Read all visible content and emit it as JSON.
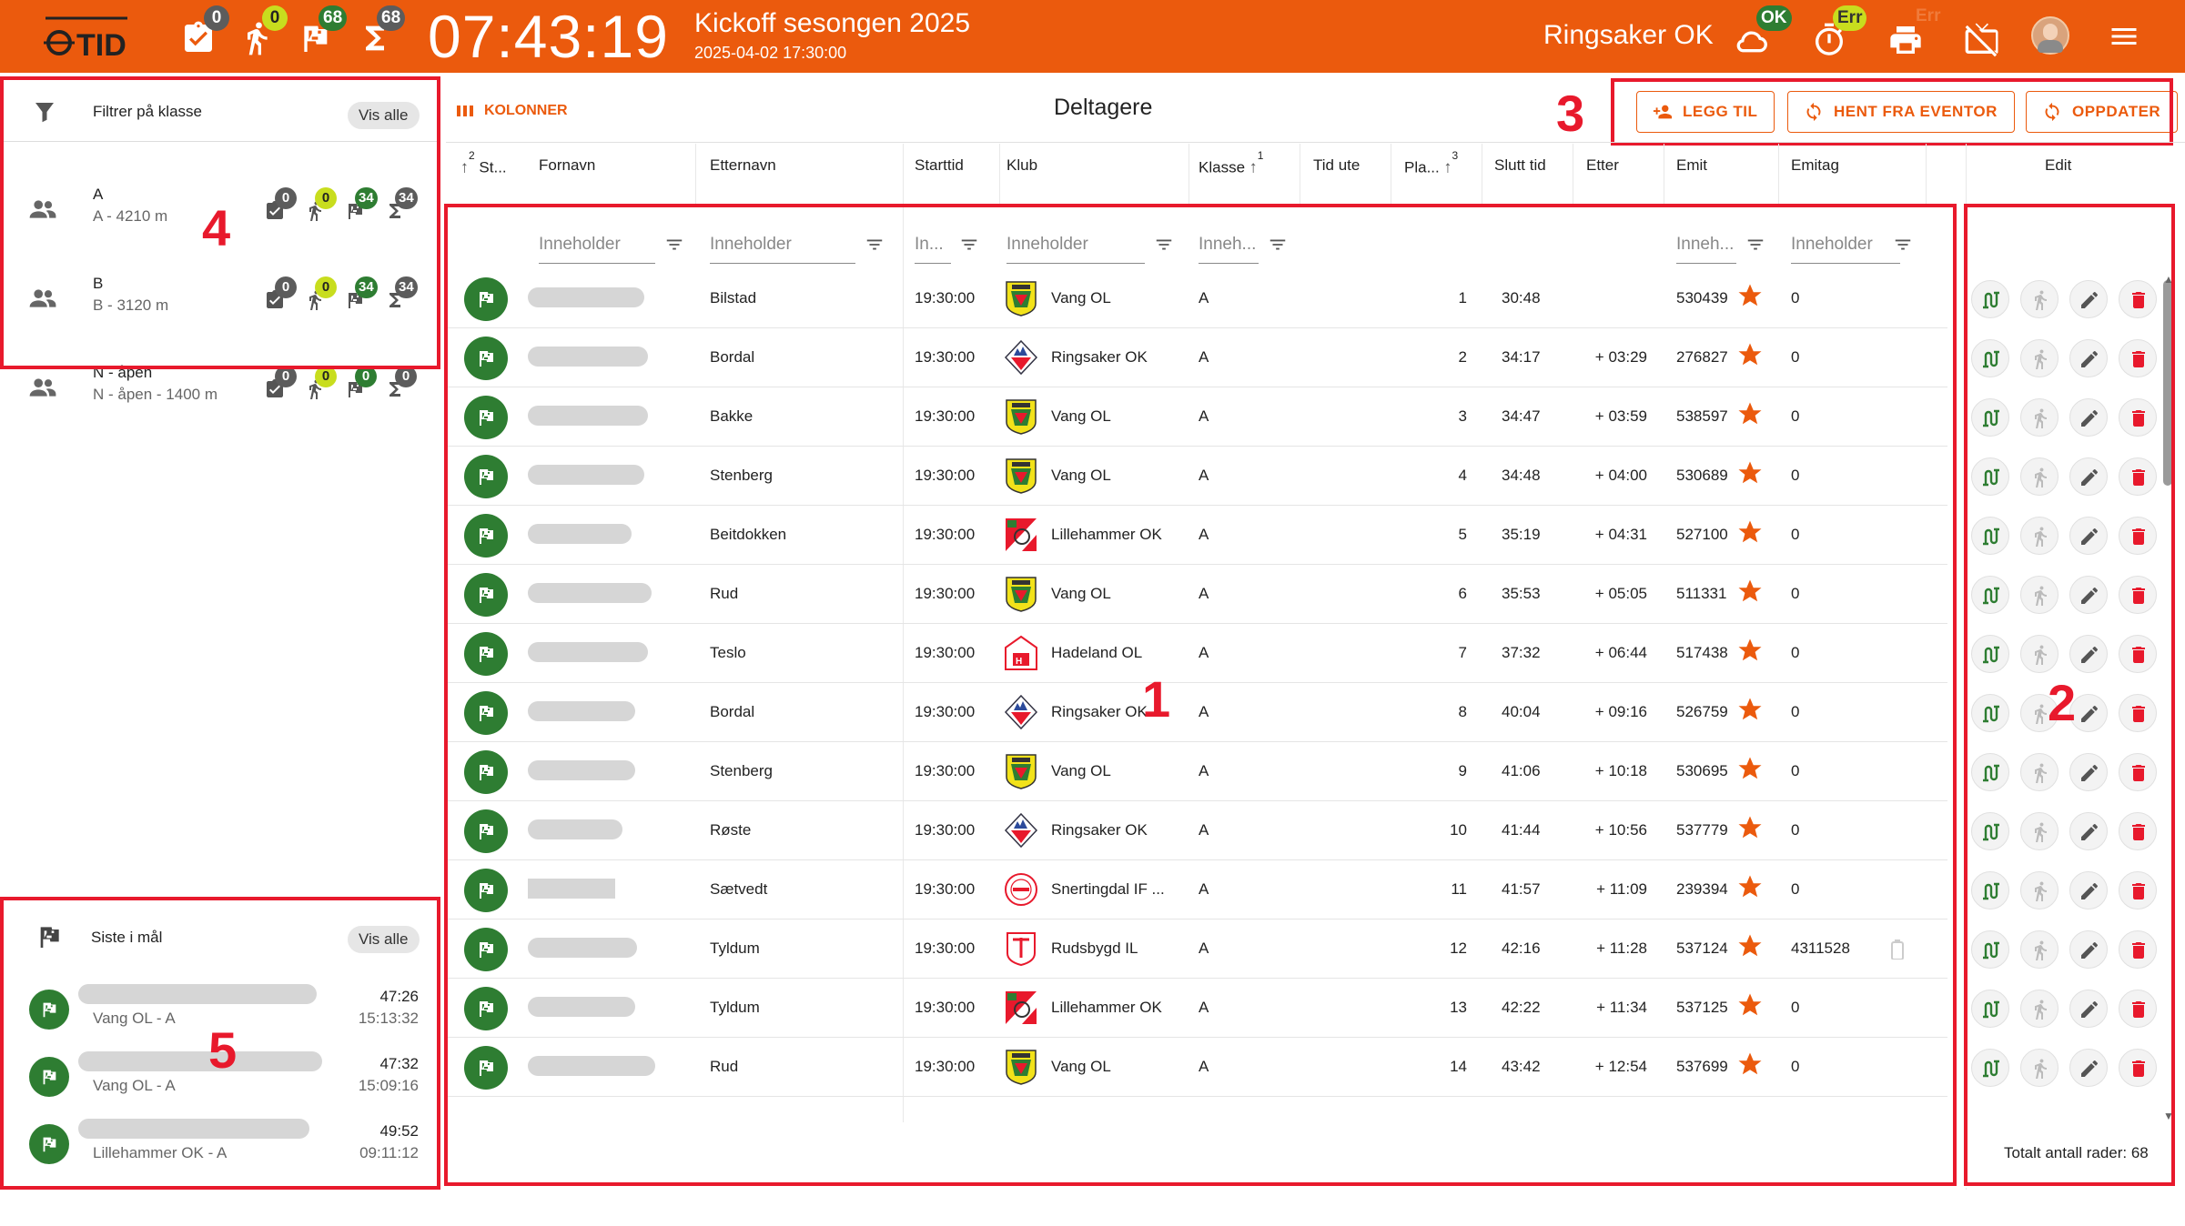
{
  "topbar": {
    "logo_text": "OTID",
    "counters": [
      {
        "icon": "clipboard-check-icon",
        "badge": "0",
        "color": "#5c5c5c"
      },
      {
        "icon": "runner-icon",
        "badge": "0",
        "color": "#c8dd1e"
      },
      {
        "icon": "finish-flag-icon",
        "badge": "68",
        "color": "#2e7d32"
      },
      {
        "icon": "sigma-icon",
        "badge": "68",
        "color": "#5c5c5c"
      }
    ],
    "clock": "07:43:19",
    "event_title": "Kickoff sesongen 2025",
    "event_datetime": "2025-04-02 17:30:00",
    "club": "Ringsaker OK",
    "cloud_status": "OK",
    "timer_status": "Err",
    "printer_status": "Err",
    "accent_color": "#eb5a0d"
  },
  "filter_panel": {
    "title": "Filtrer på klasse",
    "show_all": "Vis alle",
    "classes": [
      {
        "name": "A",
        "subtitle": "A - 4210 m",
        "counts": [
          "0",
          "0",
          "34",
          "34"
        ]
      },
      {
        "name": "B",
        "subtitle": "B - 3120 m",
        "counts": [
          "0",
          "0",
          "34",
          "34"
        ]
      },
      {
        "name": "N - åpen",
        "subtitle": "N - åpen - 1400 m",
        "counts": [
          "0",
          "0",
          "0",
          "0"
        ]
      }
    ]
  },
  "last_panel": {
    "title": "Siste i mål",
    "show_all": "Vis alle",
    "items": [
      {
        "club_class": "Vang OL - A",
        "time": "47:26",
        "clock": "15:13:32"
      },
      {
        "club_class": "Vang OL - A",
        "time": "47:32",
        "clock": "15:09:16"
      },
      {
        "club_class": "Lillehammer OK - A",
        "time": "49:52",
        "clock": "09:11:12"
      }
    ]
  },
  "main": {
    "columns_label": "KOLONNER",
    "title": "Deltagere",
    "buttons": {
      "add": "LEGG TIL",
      "fetch": "HENT FRA EVENTOR",
      "update": "OPPDATER"
    },
    "headers": {
      "status": "St...",
      "status_sort": "2",
      "first": "Fornavn",
      "last": "Etternavn",
      "start": "Starttid",
      "club": "Klub",
      "class": "Klasse",
      "class_sort": "1",
      "time_out": "Tid ute",
      "place": "Pla...",
      "place_sort": "3",
      "finish": "Slutt tid",
      "behind": "Etter",
      "emit": "Emit",
      "emitag": "Emitag",
      "edit": "Edit"
    },
    "filters": {
      "first": "Inneholder",
      "last": "Inneholder",
      "start": "In...",
      "club": "Inneholder",
      "class": "Inneh...",
      "emit": "Inneh...",
      "emitag": "Inneholder"
    },
    "rows": [
      {
        "last": "Bilstad",
        "start": "19:30:00",
        "club": "Vang OL",
        "logo": "vang",
        "class": "A",
        "place": "1",
        "finish": "30:48",
        "behind": "",
        "emit": "530439",
        "emitag": "0"
      },
      {
        "last": "Bordal",
        "start": "19:30:00",
        "club": "Ringsaker OK",
        "logo": "ringsaker",
        "class": "A",
        "place": "2",
        "finish": "34:17",
        "behind": "+ 03:29",
        "emit": "276827",
        "emitag": "0"
      },
      {
        "last": "Bakke",
        "start": "19:30:00",
        "club": "Vang OL",
        "logo": "vang",
        "class": "A",
        "place": "3",
        "finish": "34:47",
        "behind": "+ 03:59",
        "emit": "538597",
        "emitag": "0"
      },
      {
        "last": "Stenberg",
        "start": "19:30:00",
        "club": "Vang OL",
        "logo": "vang",
        "class": "A",
        "place": "4",
        "finish": "34:48",
        "behind": "+ 04:00",
        "emit": "530689",
        "emitag": "0"
      },
      {
        "last": "Beitdokken",
        "start": "19:30:00",
        "club": "Lillehammer OK",
        "logo": "lillehammer",
        "class": "A",
        "place": "5",
        "finish": "35:19",
        "behind": "+ 04:31",
        "emit": "527100",
        "emitag": "0"
      },
      {
        "last": "Rud",
        "start": "19:30:00",
        "club": "Vang OL",
        "logo": "vang",
        "class": "A",
        "place": "6",
        "finish": "35:53",
        "behind": "+ 05:05",
        "emit": "511331",
        "emitag": "0"
      },
      {
        "last": "Teslo",
        "start": "19:30:00",
        "club": "Hadeland OL",
        "logo": "hadeland",
        "class": "A",
        "place": "7",
        "finish": "37:32",
        "behind": "+ 06:44",
        "emit": "517438",
        "emitag": "0"
      },
      {
        "last": "Bordal",
        "start": "19:30:00",
        "club": "Ringsaker OK",
        "logo": "ringsaker",
        "class": "A",
        "place": "8",
        "finish": "40:04",
        "behind": "+ 09:16",
        "emit": "526759",
        "emitag": "0"
      },
      {
        "last": "Stenberg",
        "start": "19:30:00",
        "club": "Vang OL",
        "logo": "vang",
        "class": "A",
        "place": "9",
        "finish": "41:06",
        "behind": "+ 10:18",
        "emit": "530695",
        "emitag": "0"
      },
      {
        "last": "Røste",
        "start": "19:30:00",
        "club": "Ringsaker OK",
        "logo": "ringsaker",
        "class": "A",
        "place": "10",
        "finish": "41:44",
        "behind": "+ 10:56",
        "emit": "537779",
        "emitag": "0"
      },
      {
        "last": "Sætvedt",
        "start": "19:30:00",
        "club": "Snertingdal IF ...",
        "logo": "snertingdal",
        "class": "A",
        "place": "11",
        "finish": "41:57",
        "behind": "+ 11:09",
        "emit": "239394",
        "emitag": "0"
      },
      {
        "last": "Tyldum",
        "start": "19:30:00",
        "club": "Rudsbygd IL",
        "logo": "rudsbygd",
        "class": "A",
        "place": "12",
        "finish": "42:16",
        "behind": "+ 11:28",
        "emit": "537124",
        "emitag": "4311528"
      },
      {
        "last": "Tyldum",
        "start": "19:30:00",
        "club": "Lillehammer OK",
        "logo": "lillehammer",
        "class": "A",
        "place": "13",
        "finish": "42:22",
        "behind": "+ 11:34",
        "emit": "537125",
        "emitag": "0"
      },
      {
        "last": "Rud",
        "start": "19:30:00",
        "club": "Vang OL",
        "logo": "vang",
        "class": "A",
        "place": "14",
        "finish": "43:42",
        "behind": "+ 12:54",
        "emit": "537699",
        "emitag": "0"
      }
    ],
    "total_rows": "Totalt antall rader: 68"
  },
  "annotations": [
    "1",
    "2",
    "3",
    "4",
    "5"
  ],
  "status_colors": {
    "finished": "#2e7d32",
    "delete": "#e8192c",
    "annotation": "#e8192c"
  }
}
